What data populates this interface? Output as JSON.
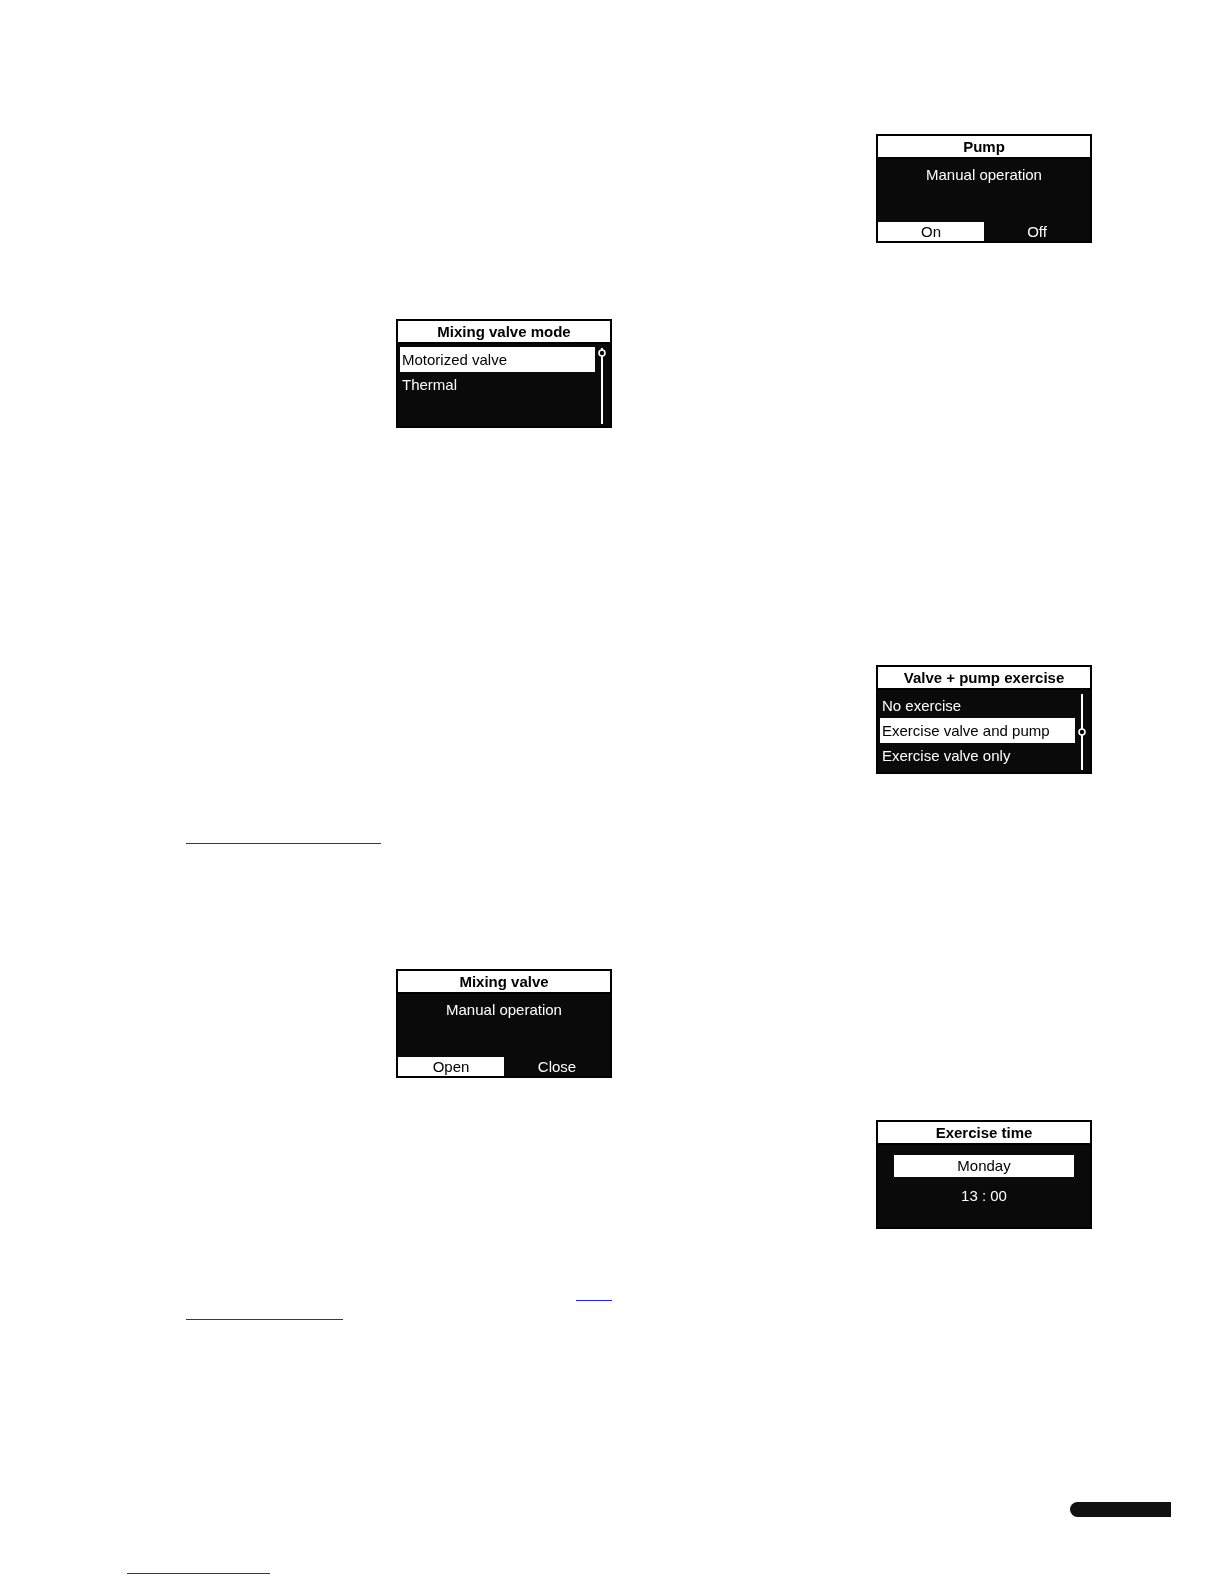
{
  "screens": [
    {
      "kind": "buttons",
      "title": "Pump",
      "message": "Manual operation",
      "buttons": [
        {
          "label": "On",
          "selected": true
        },
        {
          "label": "Off",
          "selected": false
        }
      ]
    },
    {
      "kind": "list",
      "title": "Mixing valve mode",
      "items": [
        {
          "label": "Motorized valve",
          "selected": true
        },
        {
          "label": "Thermal",
          "selected": false
        }
      ]
    },
    {
      "kind": "list",
      "title": "Valve + pump exercise",
      "items": [
        {
          "label": "No exercise",
          "selected": false
        },
        {
          "label": "Exercise valve and pump",
          "selected": true
        },
        {
          "label": "Exercise valve only",
          "selected": false
        }
      ]
    },
    {
      "kind": "buttons",
      "title": "Mixing valve",
      "message": "Manual operation",
      "buttons": [
        {
          "label": "Open",
          "selected": true
        },
        {
          "label": "Close",
          "selected": false
        }
      ]
    },
    {
      "kind": "time",
      "title": "Exercise time",
      "day": "Monday",
      "time": "13 : 00"
    }
  ]
}
